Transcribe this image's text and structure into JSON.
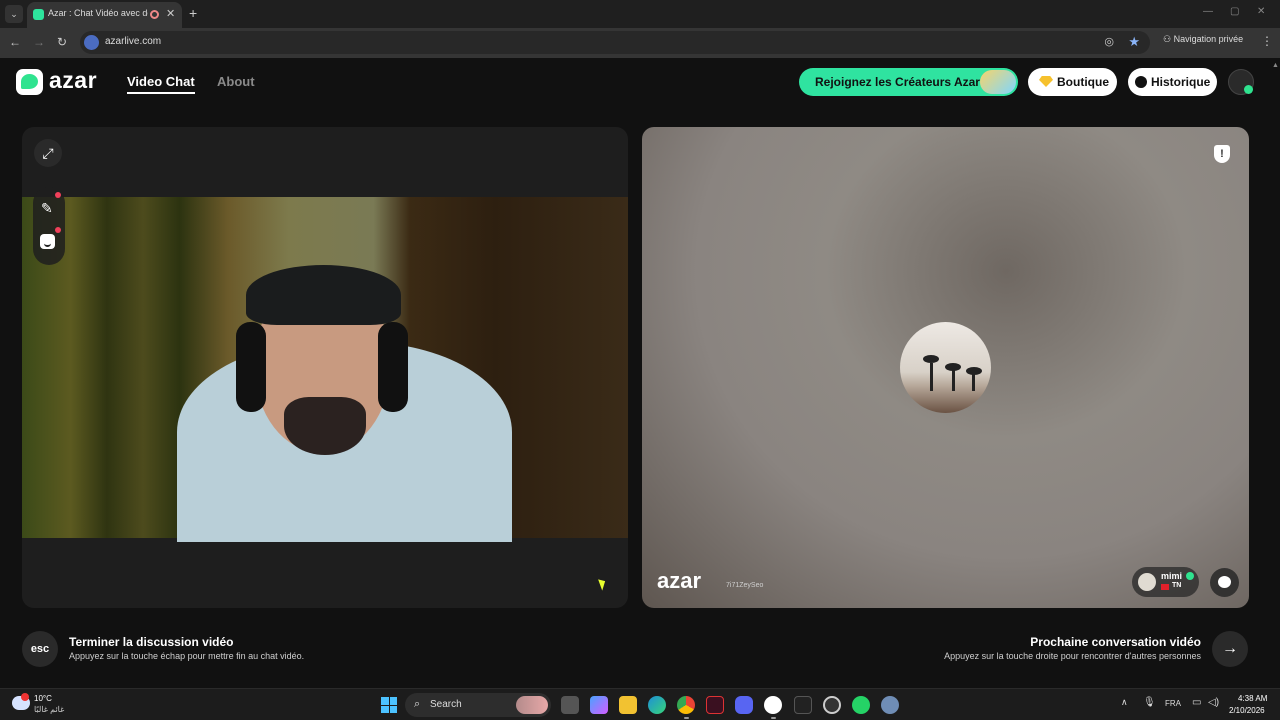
{
  "browser": {
    "tab_title": "Azar : Chat Vidéo avec de n",
    "url": "azarlive.com",
    "incognito_label": "Navigation privée",
    "accent": "#8ab4f8"
  },
  "header": {
    "logo": "azar",
    "nav": {
      "video_chat": "Video Chat",
      "about": "About"
    },
    "creators_button": "Rejoignez les Créateurs Azar",
    "boutique_button": "Boutique",
    "history_button": "Historique",
    "brand_color": "#2fe3a0"
  },
  "partner": {
    "watermark_logo": "azar",
    "watermark_id": "7i71ZeySeo",
    "name": "mimi",
    "country": "TN"
  },
  "actions": {
    "esc_label": "esc",
    "end_title": "Terminer la discussion vidéo",
    "end_subtitle": "Appuyez sur la touche échap pour mettre fin au chat vidéo.",
    "next_title": "Prochaine conversation vidéo",
    "next_subtitle": "Appuyez sur la touche droite pour rencontrer d'autres personnes",
    "next_icon": "→"
  },
  "taskbar": {
    "weather_temp": "10°C",
    "weather_desc": "غائم غالبًا",
    "search_label": "Search",
    "language": "FRA",
    "time": "4:38 AM",
    "date": "2/10/2026"
  }
}
